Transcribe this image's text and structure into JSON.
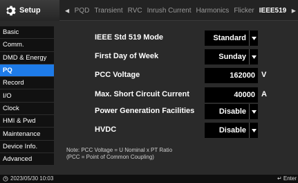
{
  "header": {
    "setup_label": "Setup",
    "tabs": [
      "PQD",
      "Transient",
      "RVC",
      "Inrush Current",
      "Harmonics",
      "Flicker",
      "IEEE519"
    ],
    "active_tab": "IEEE519"
  },
  "sidebar": {
    "items": [
      "Basic",
      "Comm.",
      "DMD & Energy",
      "PQ",
      "Record",
      "I/O",
      "Clock",
      "HMI & Pwd",
      "Maintenance",
      "Device Info.",
      "Advanced"
    ],
    "active": "PQ"
  },
  "settings": {
    "mode": {
      "label": "IEEE Std 519 Mode",
      "value": "Standard"
    },
    "first_day": {
      "label": "First Day of Week",
      "value": "Sunday"
    },
    "pcc_voltage": {
      "label": "PCC Voltage",
      "value": "162000",
      "unit": "V"
    },
    "max_sc_current": {
      "label": "Max. Short Circuit Current",
      "value": "40000",
      "unit": "A"
    },
    "power_gen": {
      "label": "Power Generation Facilities",
      "value": "Disable"
    },
    "hvdc": {
      "label": "HVDC",
      "value": "Disable"
    }
  },
  "note": {
    "line1": "Note: PCC Voltage = U Nominal x PT Ratio",
    "line2": "(PCC = Point of Common Coupling)"
  },
  "status": {
    "datetime": "2023/05/30 10:03",
    "enter_label": "Enter"
  }
}
